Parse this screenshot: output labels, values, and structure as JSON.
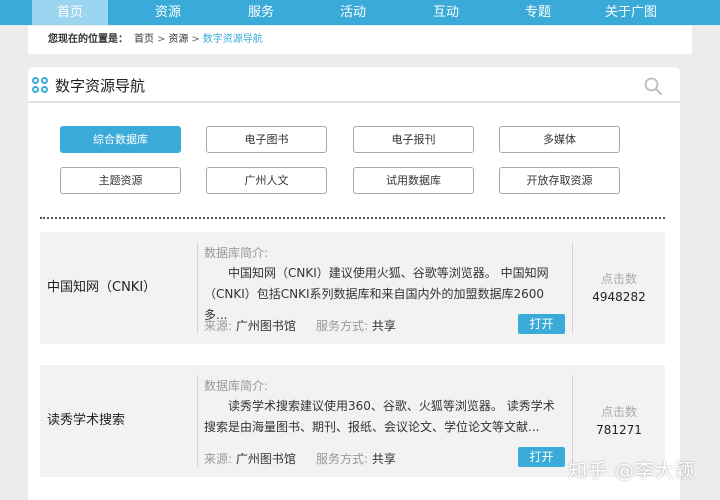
{
  "nav": {
    "items": [
      {
        "label": "首页",
        "active": true
      },
      {
        "label": "资源"
      },
      {
        "label": "服务"
      },
      {
        "label": "活动"
      },
      {
        "label": "互动"
      },
      {
        "label": "专题"
      },
      {
        "label": "关于广图"
      }
    ]
  },
  "breadcrumb": {
    "label": "您现在的位置是：",
    "items": [
      "首页",
      "资源",
      "数字资源导航"
    ],
    "separator": ">"
  },
  "panel": {
    "title": "数字资源导航",
    "icons": {
      "logo": "four-circles-icon",
      "search": "search-icon"
    }
  },
  "categories": [
    {
      "label": "综合数据库",
      "active": true
    },
    {
      "label": "电子图书"
    },
    {
      "label": "电子报刊"
    },
    {
      "label": "多媒体"
    },
    {
      "label": "主题资源"
    },
    {
      "label": "广州人文"
    },
    {
      "label": "试用数据库"
    },
    {
      "label": "开放存取资源"
    }
  ],
  "databases": [
    {
      "name": "中国知网（CNKI）",
      "intro_label": "数据库简介:",
      "description": "中国知网（CNKI）建议使用火狐、谷歌等浏览器。 中国知网（CNKI）包括CNKI系列数据库和来自国内外的加盟数据库2600多...",
      "source_label": "来源:",
      "source": "广州图书馆",
      "service_label": "服务方式:",
      "service": "共享",
      "open_label": "打开",
      "clicks_label": "点击数",
      "clicks": "4948282"
    },
    {
      "name": "读秀学术搜索",
      "intro_label": "数据库简介:",
      "description": "读秀学术搜索建议使用360、谷歌、火狐等浏览器。 读秀学术搜索是由海量图书、期刊、报纸、会议论文、学位论文等文献...",
      "source_label": "来源:",
      "source": "广州图书馆",
      "service_label": "服务方式:",
      "service": "共享",
      "open_label": "打开",
      "clicks_label": "点击数",
      "clicks": "781271"
    }
  ],
  "watermark": "知乎 @李大颖",
  "colors": {
    "accent": "#3aabd9",
    "nav_active": "#9bd5ef",
    "page_bg": "#ececec",
    "card_bg": "#f2f2f2"
  }
}
